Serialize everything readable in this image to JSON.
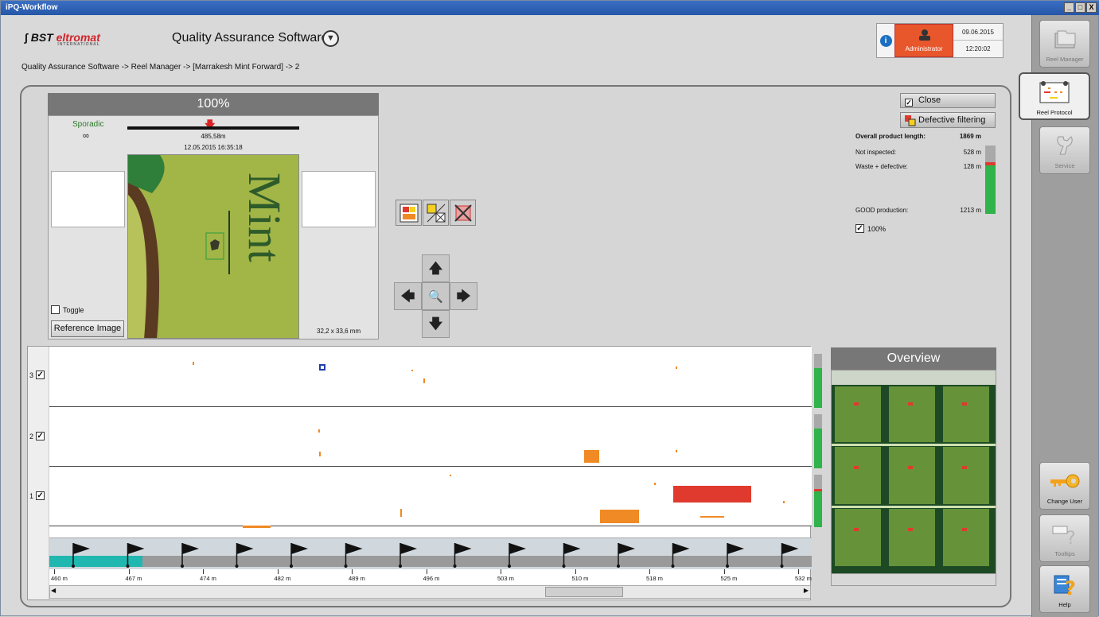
{
  "window": {
    "title": "iPQ-Workflow",
    "buttons": [
      "_",
      "□",
      "X"
    ]
  },
  "brand": {
    "name_part1": "BST",
    "name_part2": "eltromat",
    "sub": "INTERNATIONAL"
  },
  "app": {
    "title": "Quality Assurance Software",
    "menu_glyph": "▼"
  },
  "breadcrumb": "Quality Assurance Software -> Reel Manager ->  [Marrakesh Mint Forward] -> 2",
  "user": {
    "role": "Administrator",
    "date": "09.06.2015",
    "time": "12:20:02",
    "info": "i"
  },
  "sidebar": {
    "items": [
      {
        "label": "Reel Manager"
      },
      {
        "label": "Reel Protocol"
      },
      {
        "label": "Service"
      },
      {
        "label": "Change User"
      },
      {
        "label": "Tooltips"
      },
      {
        "label": "Help"
      }
    ]
  },
  "viewer": {
    "header": "100%",
    "class_label": "Sporadic",
    "class_value": "∞",
    "position": "485,58m",
    "datetime": "12.05.2015 16:35:18",
    "image_text": "Mint",
    "toggle_label": "Toggle",
    "reference_button": "Reference Image",
    "dimensions": "32,2 x 33,6 mm"
  },
  "actions": {
    "close": "Close",
    "filter": "Defective filtering"
  },
  "stats": {
    "overall_label": "Overall product length:",
    "overall_value": "1869 m",
    "not_inspected_label": "Not inspected:",
    "not_inspected_value": "528 m",
    "waste_label": "Waste + defective:",
    "waste_value": "128 m",
    "good_label": "GOOD production:",
    "good_value": "1213 m",
    "check_100": "100%",
    "bar": {
      "not_inspected": 528,
      "waste": 128,
      "good": 1213
    }
  },
  "lanes": {
    "rows": [
      {
        "label": "3"
      },
      {
        "label": "2"
      },
      {
        "label": "1"
      }
    ],
    "ticks": [
      "460 m",
      "467 m",
      "474 m",
      "482 m",
      "489 m",
      "496 m",
      "503 m",
      "510 m",
      "518 m",
      "525 m",
      "532 m"
    ]
  },
  "overview": {
    "header": "Overview"
  },
  "colors": {
    "accent": "#e8562c",
    "good": "#2fb34a",
    "waste": "#e03a2e",
    "defect_orange": "#f08a24",
    "teal": "#20b7b0"
  }
}
